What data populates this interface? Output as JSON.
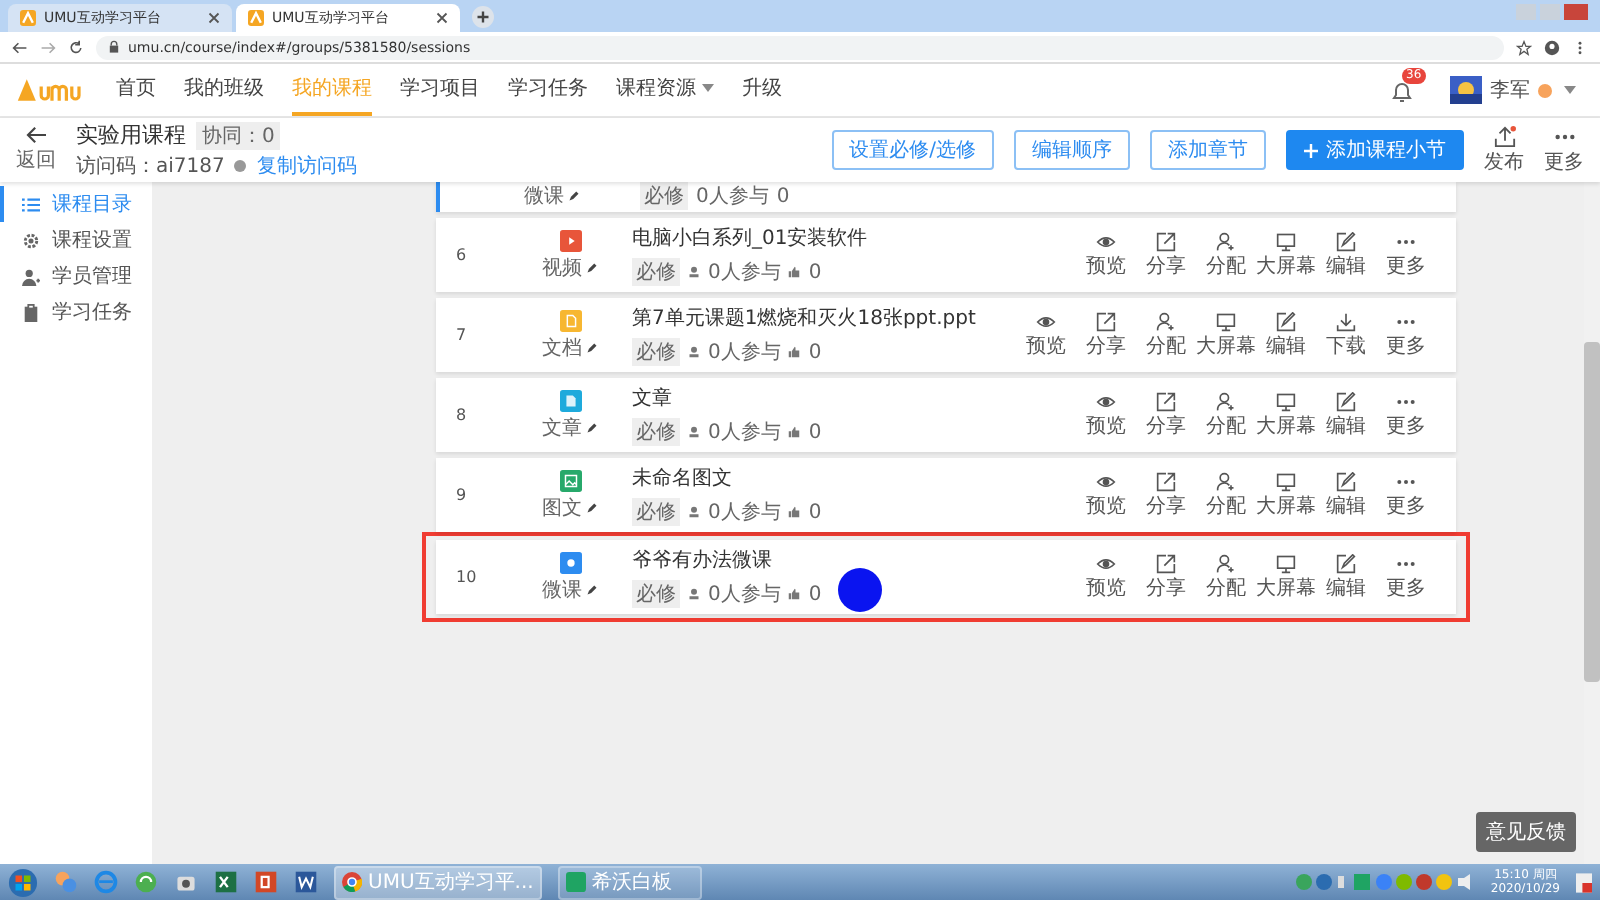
{
  "browser": {
    "tabs": [
      {
        "title": "UMU互动学习平台",
        "selected": false
      },
      {
        "title": "UMU互动学习平台",
        "selected": true
      }
    ],
    "address": "umu.cn/course/index#/groups/5381580/sessions"
  },
  "nav": {
    "items": [
      {
        "label": "首页",
        "selected": false,
        "dropdown": false
      },
      {
        "label": "我的班级",
        "selected": false,
        "dropdown": false
      },
      {
        "label": "我的课程",
        "selected": true,
        "dropdown": false
      },
      {
        "label": "学习项目",
        "selected": false,
        "dropdown": false
      },
      {
        "label": "学习任务",
        "selected": false,
        "dropdown": false
      },
      {
        "label": "课程资源",
        "selected": false,
        "dropdown": true
      },
      {
        "label": "升级",
        "selected": false,
        "dropdown": false
      }
    ],
    "notifications": "36",
    "user": "李军"
  },
  "course": {
    "back": "返回",
    "title": "实验用课程",
    "collab": "协同：0",
    "access_code": "访问码：ai7187",
    "copy_link": "复制访问码",
    "buttons": [
      {
        "label": "设置必修/选修",
        "kind": "outline"
      },
      {
        "label": "编辑顺序",
        "kind": "outline"
      },
      {
        "label": "添加章节",
        "kind": "outline"
      },
      {
        "label": "添加课程小节",
        "kind": "primary"
      }
    ],
    "tools": [
      {
        "label": "发布",
        "kind": "publish"
      },
      {
        "label": "更多",
        "kind": "more"
      }
    ]
  },
  "sidebar": {
    "items": [
      {
        "label": "课程目录",
        "kind": "list",
        "selected": true
      },
      {
        "label": "课程设置",
        "kind": "gear",
        "selected": false
      },
      {
        "label": "学员管理",
        "kind": "people",
        "selected": false
      },
      {
        "label": "学习任务",
        "kind": "clipboard",
        "selected": false
      }
    ]
  },
  "partial_row": {
    "type_label": "微课",
    "tag": "必修",
    "participants": "0人参与",
    "likes": "0",
    "selected": true
  },
  "rows": [
    {
      "number": "6",
      "type_label": "视频",
      "kind": "video",
      "color": "#e8553a",
      "title": "电脑小白系列_01安装软件",
      "tag": "必修",
      "participants": "0人参与",
      "likes": "0",
      "highlighted": false,
      "clicked": false,
      "actions": [
        {
          "kind": "preview",
          "label": "预览"
        },
        {
          "kind": "share",
          "label": "分享"
        },
        {
          "kind": "assign",
          "label": "分配"
        },
        {
          "kind": "screen",
          "label": "大屏幕"
        },
        {
          "kind": "edit",
          "label": "编辑"
        },
        {
          "kind": "more",
          "label": "更多"
        }
      ]
    },
    {
      "number": "7",
      "type_label": "文档",
      "kind": "doc",
      "color": "#f7b731",
      "title": "第7单元课题1燃烧和灭火18张ppt.ppt",
      "tag": "必修",
      "participants": "0人参与",
      "likes": "0",
      "highlighted": false,
      "clicked": false,
      "actions": [
        {
          "kind": "preview",
          "label": "预览"
        },
        {
          "kind": "share",
          "label": "分享"
        },
        {
          "kind": "assign",
          "label": "分配"
        },
        {
          "kind": "screen",
          "label": "大屏幕"
        },
        {
          "kind": "edit",
          "label": "编辑"
        },
        {
          "kind": "download",
          "label": "下载"
        },
        {
          "kind": "more",
          "label": "更多"
        }
      ]
    },
    {
      "number": "8",
      "type_label": "文章",
      "kind": "article",
      "color": "#1eaadc",
      "title": "文章",
      "tag": "必修",
      "participants": "0人参与",
      "likes": "0",
      "highlighted": false,
      "clicked": false,
      "actions": [
        {
          "kind": "preview",
          "label": "预览"
        },
        {
          "kind": "share",
          "label": "分享"
        },
        {
          "kind": "assign",
          "label": "分配"
        },
        {
          "kind": "screen",
          "label": "大屏幕"
        },
        {
          "kind": "edit",
          "label": "编辑"
        },
        {
          "kind": "more",
          "label": "更多"
        }
      ]
    },
    {
      "number": "9",
      "type_label": "图文",
      "kind": "image",
      "color": "#27a96b",
      "title": "未命名图文",
      "tag": "必修",
      "participants": "0人参与",
      "likes": "0",
      "highlighted": false,
      "clicked": false,
      "actions": [
        {
          "kind": "preview",
          "label": "预览"
        },
        {
          "kind": "share",
          "label": "分享"
        },
        {
          "kind": "assign",
          "label": "分配"
        },
        {
          "kind": "screen",
          "label": "大屏幕"
        },
        {
          "kind": "edit",
          "label": "编辑"
        },
        {
          "kind": "more",
          "label": "更多"
        }
      ]
    },
    {
      "number": "10",
      "type_label": "微课",
      "kind": "micro",
      "color": "#2d8cf0",
      "title": "爷爷有办法微课",
      "tag": "必修",
      "participants": "0人参与",
      "likes": "0",
      "highlighted": true,
      "clicked": true,
      "actions": [
        {
          "kind": "preview",
          "label": "预览"
        },
        {
          "kind": "share",
          "label": "分享"
        },
        {
          "kind": "assign",
          "label": "分配"
        },
        {
          "kind": "screen",
          "label": "大屏幕"
        },
        {
          "kind": "edit",
          "label": "编辑"
        },
        {
          "kind": "more",
          "label": "更多"
        }
      ]
    }
  ],
  "feedback": "意见反馈",
  "taskbar": {
    "tasks": [
      {
        "label": "UMU互动学习平...",
        "kind": "chrome",
        "selected": true
      },
      {
        "label": "希沃白板",
        "kind": "easinote",
        "selected": false
      }
    ],
    "time": "15:10 周四",
    "date": "2020/10/29"
  }
}
